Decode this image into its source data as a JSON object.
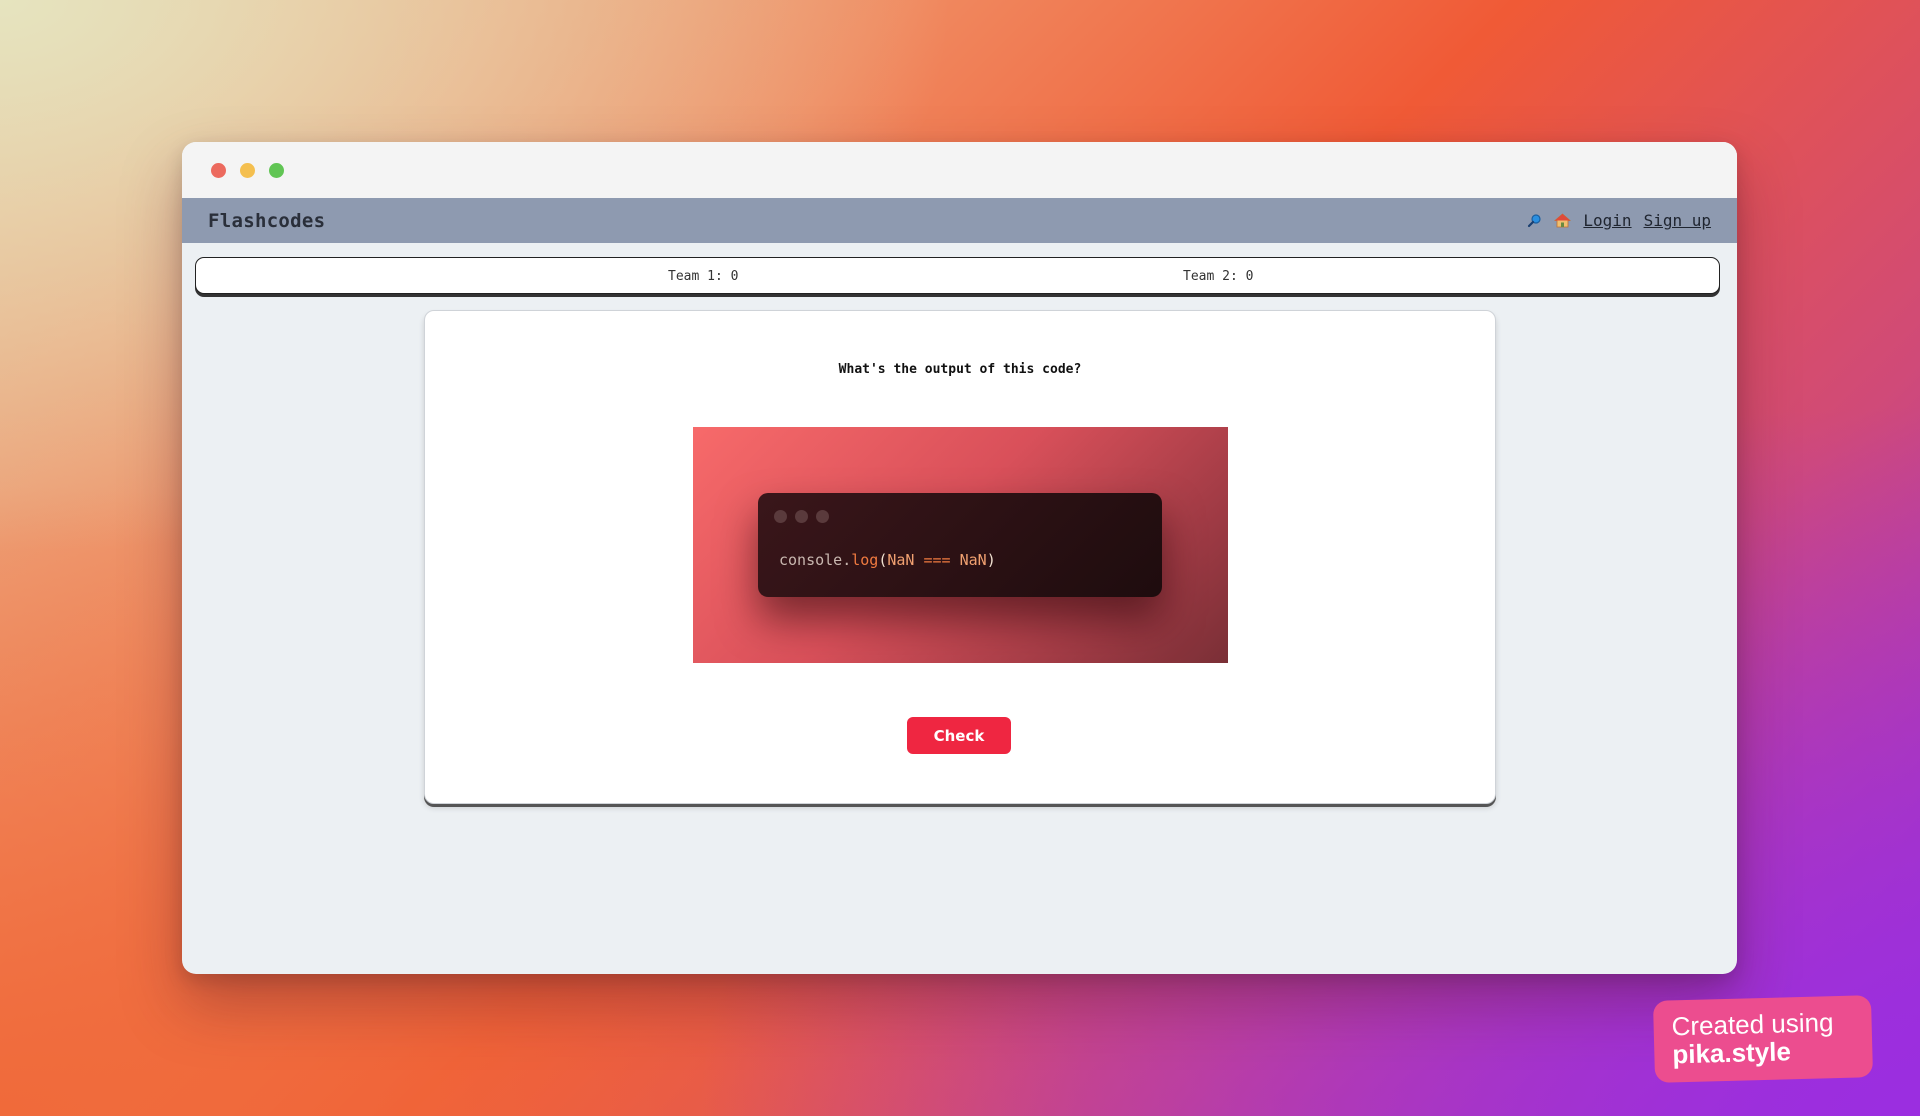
{
  "app": {
    "brand": "Flashcodes"
  },
  "nav": {
    "search_icon": "magnifier-icon",
    "home_icon": "house-icon",
    "login_label": "Login",
    "signup_label": "Sign up"
  },
  "scoreboard": {
    "team1": "Team 1: 0",
    "team2": "Team 2: 0"
  },
  "card": {
    "question": "What's the output of this code?",
    "code": {
      "object": "console",
      "dot": ".",
      "method": "log",
      "open_paren": "(",
      "left_operand": "NaN",
      "operator": "===",
      "right_operand": "NaN",
      "close_paren": ")"
    },
    "check_label": "Check"
  },
  "watermark": {
    "line1": "Created using",
    "line2": "pika.style"
  },
  "colors": {
    "navbar": "#8e9ab0",
    "check_button": "#ef2641",
    "watermark": "#ec4d8f"
  }
}
